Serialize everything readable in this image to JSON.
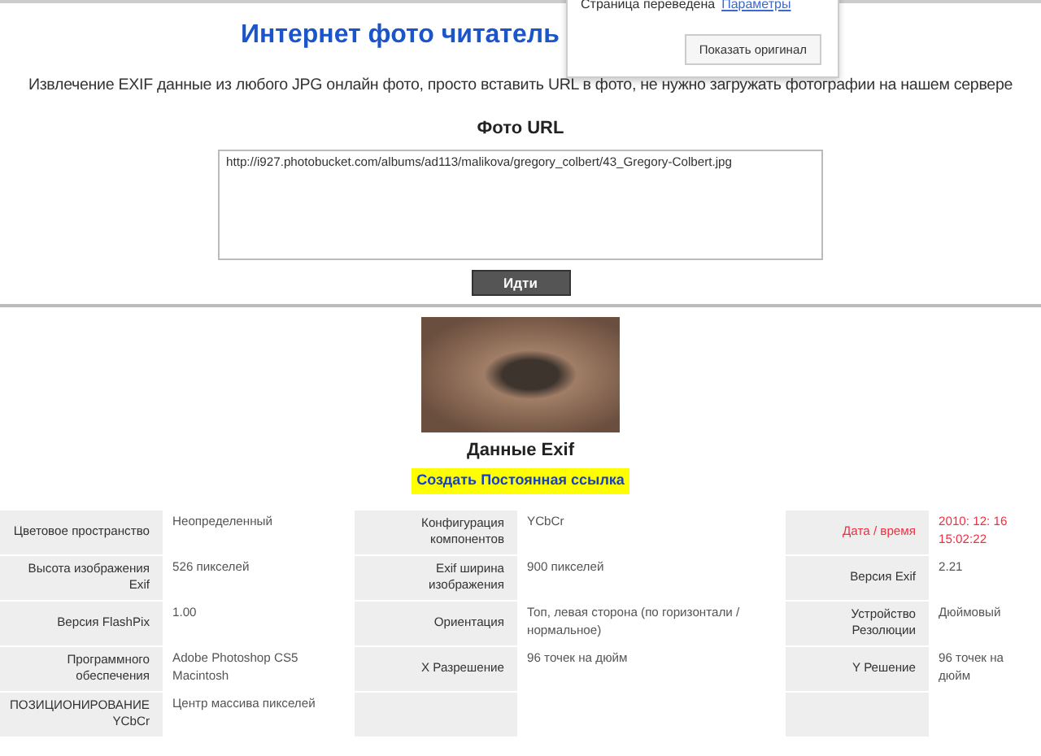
{
  "page": {
    "title": "Интернет фото читатель",
    "subtitle": "Извлечение EXIF данные из любого JPG онлайн фото, просто вставить URL в фото, не нужно загружать фотографии на нашем сервере"
  },
  "translate_popup": {
    "message": "Страница переведена",
    "options_link": "Параметры",
    "button": "Показать оригинал"
  },
  "form": {
    "label": "Фото URL",
    "url": "http://i927.photobucket.com/albums/ad113/malikova/gregory_colbert/43_Gregory-Colbert.jpg",
    "submit": "Идти"
  },
  "result": {
    "heading": "Данные Exif",
    "permalink": "Создать Постоянная ссылка"
  },
  "exif_groups": [
    {
      "rows": [
        {
          "label": "Цветовое пространство",
          "value": "Неопределенный",
          "alert": false
        },
        {
          "label": "Высота изображения Exif",
          "value": "526 пикселей",
          "alert": false
        },
        {
          "label": "Версия FlashPix",
          "value": "1.00",
          "alert": false
        },
        {
          "label": "Программного обеспечения",
          "value": "Adobe Photoshop CS5 Macintosh",
          "alert": false
        },
        {
          "label": "ПОЗИЦИОНИРОВАНИЕ YCbCr",
          "value": "Центр массива пикселей",
          "alert": false
        }
      ]
    },
    {
      "rows": [
        {
          "label": "Конфигурация компонентов",
          "value": "YCbCr",
          "alert": false
        },
        {
          "label": "Exif ширина изображения",
          "value": "900 пикселей",
          "alert": false
        },
        {
          "label": "Ориентация",
          "value": "Топ, левая сторона (по горизонтали / нормальное)",
          "alert": false
        },
        {
          "label": "X Разрешение",
          "value": "96 точек на дюйм",
          "alert": false
        }
      ]
    },
    {
      "rows": [
        {
          "label": "Дата / время",
          "value": "2010: 12: 16 15:02:22",
          "alert": true
        },
        {
          "label": "Версия Exif",
          "value": "2.21",
          "alert": false
        },
        {
          "label": "Устройство Резолюции",
          "value": "Дюймовый",
          "alert": false
        },
        {
          "label": "Y Решение",
          "value": "96 точек на дюйм",
          "alert": false
        }
      ]
    }
  ]
}
